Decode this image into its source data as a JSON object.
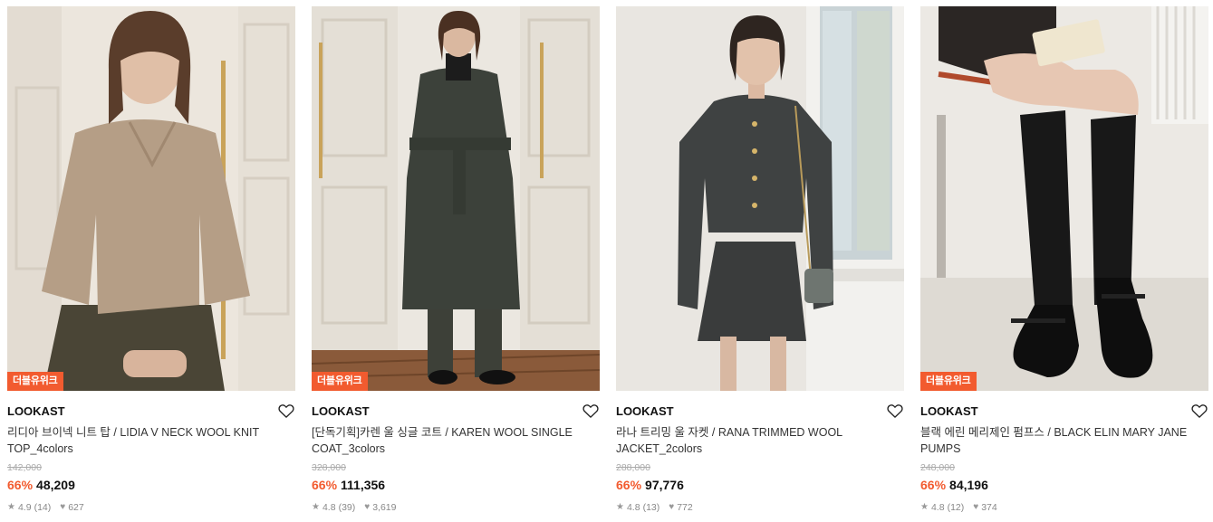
{
  "products": [
    {
      "brand": "LOOKAST",
      "badge": "더블유위크",
      "title": "리디아 브이넥 니트 탑 / LIDIA V NECK WOOL KNIT TOP_4colors",
      "original_price": "142,000",
      "discount": "66%",
      "price": "48,209",
      "rating": "4.9",
      "review_count": "(14)",
      "likes": "627"
    },
    {
      "brand": "LOOKAST",
      "badge": "더블유위크",
      "title": "[단독기획]카렌 울 싱글 코트 / KAREN WOOL SINGLE COAT_3colors",
      "original_price": "328,000",
      "discount": "66%",
      "price": "111,356",
      "rating": "4.8",
      "review_count": "(39)",
      "likes": "3,619"
    },
    {
      "brand": "LOOKAST",
      "badge": "",
      "title": "라나 트리밍 울 자켓 / RANA TRIMMED WOOL JACKET_2colors",
      "original_price": "288,000",
      "discount": "66%",
      "price": "97,776",
      "rating": "4.8",
      "review_count": "(13)",
      "likes": "772"
    },
    {
      "brand": "LOOKAST",
      "badge": "더블유위크",
      "title": "블랙 에린 메리제인 펌프스 / BLACK ELIN MARY JANE PUMPS",
      "original_price": "248,000",
      "discount": "66%",
      "price": "84,196",
      "rating": "4.8",
      "review_count": "(12)",
      "likes": "374"
    }
  ],
  "icons": {
    "like": "heart-outline-icon",
    "rating": "star-icon",
    "likes": "heart-filled-icon"
  },
  "colors": {
    "accent": "#f25b2f",
    "text": "#111111",
    "muted": "#888888"
  }
}
